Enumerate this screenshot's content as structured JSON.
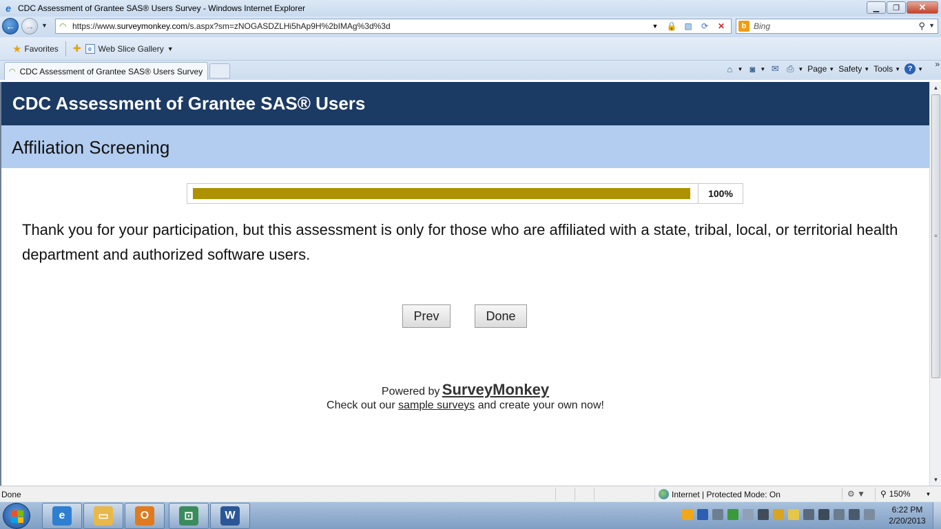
{
  "window": {
    "title": "CDC Assessment of Grantee SAS® Users Survey - Windows Internet Explorer",
    "minimize": "▁",
    "maximize": "❐",
    "close": "✕"
  },
  "addressbar": {
    "url_prefix": "https://www.",
    "url_host": "surveymonkey.com",
    "url_path": "/s.aspx?sm=zNOGASDZLHi5hAp9H%2bIMAg%3d%3d",
    "search_placeholder": "Bing"
  },
  "favorites": {
    "favorites_label": "Favorites",
    "web_slice_label": "Web Slice Gallery"
  },
  "tabs": [
    {
      "label": "CDC Assessment of Grantee SAS® Users Survey"
    }
  ],
  "commandbar": {
    "page": "Page",
    "safety": "Safety",
    "tools": "Tools"
  },
  "survey": {
    "title": "CDC Assessment of Grantee SAS® Users",
    "page_title": "Affiliation Screening",
    "progress": 100,
    "progress_label": "100%",
    "message": "Thank you for your participation, but this assessment is only for those who are affiliated with a state, tribal, local, or territorial health department and authorized software users.",
    "prev_label": "Prev",
    "done_label": "Done"
  },
  "footer": {
    "powered_by": "Powered by",
    "brand": "SurveyMonkey",
    "cta_prefix": "Check out our",
    "cta_link": "sample surveys",
    "cta_suffix": "and create your own now!"
  },
  "statusbar": {
    "status": "Done",
    "zone": "Internet | Protected Mode: On",
    "zoom": "150%"
  },
  "taskbar": {
    "apps": [
      {
        "name": "Internet Explorer",
        "icon": "ie-icon",
        "color": "#2f7fd1"
      },
      {
        "name": "Windows Explorer",
        "icon": "folder-icon",
        "color": "#e8b84a"
      },
      {
        "name": "Outlook",
        "icon": "outlook-icon",
        "color": "#e07a1f"
      },
      {
        "name": "Remote Desktop",
        "icon": "remote-desktop-icon",
        "color": "#3a8c5c"
      },
      {
        "name": "Word",
        "icon": "word-icon",
        "color": "#2b5797"
      }
    ],
    "time": "6:22 PM",
    "date": "2/20/2013"
  }
}
